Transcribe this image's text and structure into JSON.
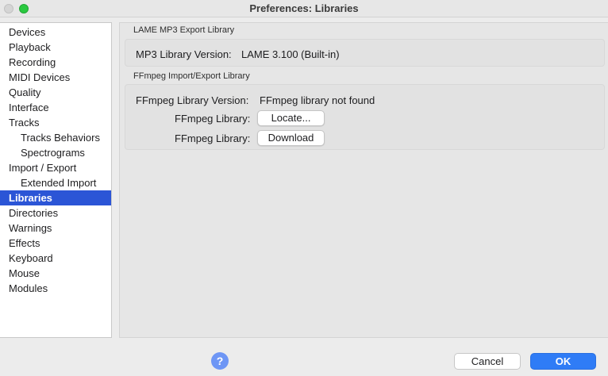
{
  "window": {
    "title": "Preferences: Libraries"
  },
  "sidebar": {
    "items": [
      {
        "label": "Devices"
      },
      {
        "label": "Playback"
      },
      {
        "label": "Recording"
      },
      {
        "label": "MIDI Devices"
      },
      {
        "label": "Quality"
      },
      {
        "label": "Interface"
      },
      {
        "label": "Tracks"
      },
      {
        "label": "Tracks Behaviors"
      },
      {
        "label": "Spectrograms"
      },
      {
        "label": "Import / Export"
      },
      {
        "label": "Extended Import"
      },
      {
        "label": "Libraries"
      },
      {
        "label": "Directories"
      },
      {
        "label": "Warnings"
      },
      {
        "label": "Effects"
      },
      {
        "label": "Keyboard"
      },
      {
        "label": "Mouse"
      },
      {
        "label": "Modules"
      }
    ],
    "selected": "Libraries"
  },
  "lame": {
    "group_label": "LAME MP3 Export Library",
    "version_label": "MP3 Library Version:",
    "version_value": "LAME 3.100 (Built-in)"
  },
  "ffmpeg": {
    "group_label": "FFmpeg Import/Export Library",
    "version_label": "FFmpeg Library Version:",
    "version_value": "FFmpeg library not found",
    "locate_label": "FFmpeg Library:",
    "locate_button": "Locate...",
    "download_label": "FFmpeg Library:",
    "download_button": "Download"
  },
  "footer": {
    "help_icon": "?",
    "cancel": "Cancel",
    "ok": "OK"
  }
}
